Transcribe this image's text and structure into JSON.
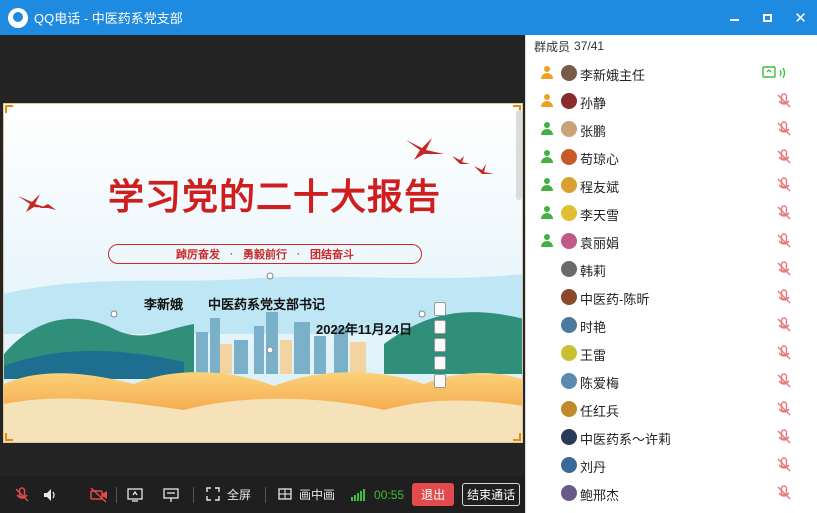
{
  "window": {
    "title": "QQ电话 - 中医药系党支部",
    "controls": {
      "minimize_icon": "minimize-icon",
      "maximize_icon": "maximize-icon",
      "close_icon": "close-icon",
      "close_glyph": "✕"
    }
  },
  "slide": {
    "title": "学习党的二十大报告",
    "banner": [
      "踔厉奋发",
      "勇毅前行",
      "团结奋斗"
    ],
    "banner_separator": "·",
    "author": "李新娥",
    "org": "中医药系党支部书记",
    "date": "2022年11月24日",
    "theme_colors": {
      "title": "#cf1e1e",
      "accent": "#e88a10",
      "sky": "#bfe6f5",
      "hills": "#2f8f7a"
    }
  },
  "toolbar": {
    "mic_icon": "mic-off-icon",
    "speaker_icon": "speaker-icon",
    "camera_icon": "camera-off-icon",
    "screen_share_icon": "screen-share-icon",
    "slides_icon": "presentation-icon",
    "fullscreen_label": "全屏",
    "pip_label": "画中画",
    "call_time": "00:55",
    "quit_label": "退出",
    "end_call_label": "结束通话"
  },
  "panel": {
    "header_label": "群成员",
    "member_count": "37/41",
    "members": [
      {
        "name": "李新娥主任",
        "status": "orange",
        "avatar_color": "#7a5a4a",
        "sharing": true
      },
      {
        "name": "孙静",
        "status": "orange",
        "avatar_color": "#8a2a2a",
        "sharing": false
      },
      {
        "name": "张鹏",
        "status": "green",
        "avatar_color": "#c9a27a",
        "sharing": false
      },
      {
        "name": "苟琼心",
        "status": "green",
        "avatar_color": "#c85a2a",
        "sharing": false
      },
      {
        "name": "程友斌",
        "status": "green",
        "avatar_color": "#d9a030",
        "sharing": false
      },
      {
        "name": "李天雪",
        "status": "green",
        "avatar_color": "#e0c030",
        "sharing": false
      },
      {
        "name": "袁丽娟",
        "status": "green",
        "avatar_color": "#c05a8a",
        "sharing": false
      },
      {
        "name": "韩莉",
        "status": "none",
        "avatar_color": "#6a6a6a",
        "sharing": false
      },
      {
        "name": "中医药-陈昕",
        "status": "none",
        "avatar_color": "#8a4a2a",
        "sharing": false
      },
      {
        "name": "时艳",
        "status": "none",
        "avatar_color": "#4a7aa0",
        "sharing": false
      },
      {
        "name": "王雷",
        "status": "none",
        "avatar_color": "#c8c030",
        "sharing": false
      },
      {
        "name": "陈爱梅",
        "status": "none",
        "avatar_color": "#5a8ab0",
        "sharing": false
      },
      {
        "name": "任红兵",
        "status": "none",
        "avatar_color": "#c08a2a",
        "sharing": false
      },
      {
        "name": "中医药系～许莉",
        "status": "none",
        "avatar_color": "#2a3a5a",
        "sharing": false
      },
      {
        "name": "刘丹",
        "status": "none",
        "avatar_color": "#3a6a9a",
        "sharing": false
      },
      {
        "name": "鲍邢杰",
        "status": "none",
        "avatar_color": "#6a5a8a",
        "sharing": false
      }
    ]
  }
}
